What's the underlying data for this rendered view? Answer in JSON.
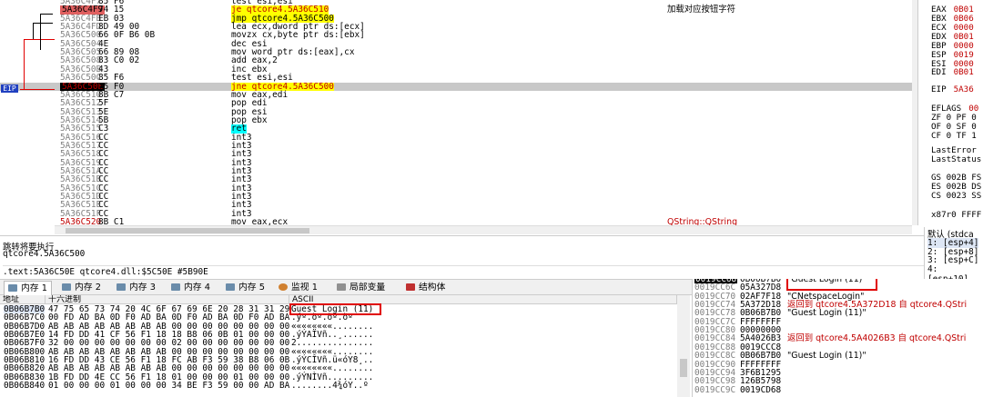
{
  "disasm": {
    "eip_label": "EIP",
    "rows": [
      {
        "addr": "5A36C4F7",
        "bytes": "85 F6",
        "instr": "test esi,esi",
        "cmt": "",
        "style": ""
      },
      {
        "addr": "5A36C4F9",
        "bytes": "74 15",
        "instr": "je qtcore4.5A36C510",
        "cmt": "加载对应按钮字符",
        "style": "sel"
      },
      {
        "addr": "5A36C4FB",
        "bytes": "EB 03",
        "instr": "jmp qtcore4.5A36C500",
        "cmt": "",
        "style": "jmp"
      },
      {
        "addr": "5A36C4FD",
        "bytes": "8D 49 00",
        "instr": "lea ecx,dword ptr ds:[ecx]",
        "cmt": "",
        "style": ""
      },
      {
        "addr": "5A36C500",
        "bytes": "66 0F B6 0B",
        "instr": "movzx cx,byte ptr ds:[ebx]",
        "cmt": "",
        "style": ""
      },
      {
        "addr": "5A36C504",
        "bytes": "4E",
        "instr": "dec esi",
        "cmt": "",
        "style": ""
      },
      {
        "addr": "5A36C505",
        "bytes": "66 89 08",
        "instr": "mov word ptr ds:[eax],cx",
        "cmt": "",
        "style": ""
      },
      {
        "addr": "5A36C508",
        "bytes": "83 C0 02",
        "instr": "add eax,2",
        "cmt": "",
        "style": ""
      },
      {
        "addr": "5A36C50B",
        "bytes": "43",
        "instr": "inc ebx",
        "cmt": "",
        "style": ""
      },
      {
        "addr": "5A36C50C",
        "bytes": "85 F6",
        "instr": "test esi,esi",
        "cmt": "",
        "style": ""
      },
      {
        "addr": "5A36C50E",
        "bytes": "75 F0",
        "instr": "jne qtcore4.5A36C500",
        "cmt": "",
        "style": "eip"
      },
      {
        "addr": "5A36C510",
        "bytes": "8B C7",
        "instr": "mov eax,edi",
        "cmt": "",
        "style": ""
      },
      {
        "addr": "5A36C512",
        "bytes": "5F",
        "instr": "pop edi",
        "cmt": "",
        "style": ""
      },
      {
        "addr": "5A36C513",
        "bytes": "5E",
        "instr": "pop esi",
        "cmt": "",
        "style": ""
      },
      {
        "addr": "5A36C514",
        "bytes": "5B",
        "instr": "pop ebx",
        "cmt": "",
        "style": ""
      },
      {
        "addr": "5A36C515",
        "bytes": "C3",
        "instr": "ret",
        "cmt": "",
        "style": "ret"
      },
      {
        "addr": "5A36C516",
        "bytes": "CC",
        "instr": "int3",
        "cmt": "",
        "style": ""
      },
      {
        "addr": "5A36C517",
        "bytes": "CC",
        "instr": "int3",
        "cmt": "",
        "style": ""
      },
      {
        "addr": "5A36C518",
        "bytes": "CC",
        "instr": "int3",
        "cmt": "",
        "style": ""
      },
      {
        "addr": "5A36C519",
        "bytes": "CC",
        "instr": "int3",
        "cmt": "",
        "style": ""
      },
      {
        "addr": "5A36C51A",
        "bytes": "CC",
        "instr": "int3",
        "cmt": "",
        "style": ""
      },
      {
        "addr": "5A36C51B",
        "bytes": "CC",
        "instr": "int3",
        "cmt": "",
        "style": ""
      },
      {
        "addr": "5A36C51C",
        "bytes": "CC",
        "instr": "int3",
        "cmt": "",
        "style": ""
      },
      {
        "addr": "5A36C51D",
        "bytes": "CC",
        "instr": "int3",
        "cmt": "",
        "style": ""
      },
      {
        "addr": "5A36C51E",
        "bytes": "CC",
        "instr": "int3",
        "cmt": "",
        "style": ""
      },
      {
        "addr": "5A36C51F",
        "bytes": "CC",
        "instr": "int3",
        "cmt": "",
        "style": ""
      },
      {
        "addr": "5A36C520",
        "bytes": "8B C1",
        "instr": "mov eax,ecx",
        "cmt": "QString::QString",
        "style": "red"
      }
    ]
  },
  "registers": {
    "rows": [
      {
        "name": "EAX",
        "val": "0B01"
      },
      {
        "name": "EBX",
        "val": "0B06"
      },
      {
        "name": "ECX",
        "val": "0000"
      },
      {
        "name": "EDX",
        "val": "0B01"
      },
      {
        "name": "EBP",
        "val": "0000"
      },
      {
        "name": "ESP",
        "val": "0019"
      },
      {
        "name": "ESI",
        "val": "0000"
      },
      {
        "name": "EDI",
        "val": "0B01"
      },
      {
        "name": "EIP",
        "val": "5A36"
      },
      {
        "name": "EFLAGS",
        "val": "00"
      },
      {
        "name": "ZF 0  PF 0",
        "val": ""
      },
      {
        "name": "OF 0  SF 0",
        "val": ""
      },
      {
        "name": "CF 0  TF 1",
        "val": ""
      },
      {
        "name": "LastError",
        "val": ""
      },
      {
        "name": "LastStatus",
        "val": ""
      },
      {
        "name": "GS 002B  FS",
        "val": ""
      },
      {
        "name": "ES 002B  DS",
        "val": ""
      },
      {
        "name": "CS 0023  SS",
        "val": ""
      },
      {
        "name": "x87r0 FFFF",
        "val": ""
      }
    ]
  },
  "info": {
    "line1": "跳转将要执行",
    "line2": "qtcore4.5A36C500",
    "line3": ".text:5A36C50E qtcore4.dll:$5C50E #5B90E"
  },
  "callstack": {
    "header": "默认 (stdca",
    "rows": [
      "1: [esp+4]",
      "2: [esp+8]",
      "3: [esp+C]",
      "4: [esp+10]"
    ]
  },
  "tabs": [
    {
      "label": "内存 1",
      "active": true
    },
    {
      "label": "内存 2",
      "active": false
    },
    {
      "label": "内存 3",
      "active": false
    },
    {
      "label": "内存 4",
      "active": false
    },
    {
      "label": "内存 5",
      "active": false
    },
    {
      "label": "监视 1",
      "active": false
    },
    {
      "label": "局部变量",
      "active": false
    },
    {
      "label": "结构体",
      "active": false
    }
  ],
  "dump": {
    "col_addr": "地址",
    "col_hex": "十六进制",
    "col_ascii": "ASCII",
    "rows": [
      {
        "addr": "0B06B7B0",
        "hex": "47 75 65 73 74 20 4C 6F 67 69 6E 20 28 31 31 29",
        "ascii": "Guest Login (11)"
      },
      {
        "addr": "0B06B7C0",
        "hex": "00 FD AD BA 0D F0 AD BA 0D F0 AD BA 0D F0 AD BA",
        "ascii": ".ý­º.ð­º.ð­º.ð­º"
      },
      {
        "addr": "0B06B7D0",
        "hex": "AB AB AB AB AB AB AB AB 00 00 00 00 00 00 00 00",
        "ascii": "««««««««........"
      },
      {
        "addr": "0B06B7E0",
        "hex": "14 FD DD 41 CF 56 F1 18 18 B8 06 0B 01 00 00 00",
        "ascii": ".ýÝAÏVñ..¸......"
      },
      {
        "addr": "0B06B7F0",
        "hex": "32 00 00 00 00 00 00 00 02 00 00 00 00 00 00 00",
        "ascii": "2..............."
      },
      {
        "addr": "0B06B800",
        "hex": "AB AB AB AB AB AB AB AB 00 00 00 00 00 00 00 00",
        "ascii": "««««««««........"
      },
      {
        "addr": "0B06B810",
        "hex": "16 FD DD 43 CE 56 F1 18 FC AB F3 59 38 B8 06 0B",
        "ascii": ".ýÝCÎVñ.ü«óY8¸.."
      },
      {
        "addr": "0B06B820",
        "hex": "AB AB AB AB AB AB AB AB 00 00 00 00 00 00 00 00",
        "ascii": "««««««««........"
      },
      {
        "addr": "0B06B830",
        "hex": "1B FD DD 4E CC 56 F1 18 01 00 00 00 01 00 00 00",
        "ascii": ".ýÝNÌVñ........."
      },
      {
        "addr": "0B06B840",
        "hex": "01 00 00 00 01 00 00 00 34 BE F3 59 00 00 AD BA",
        "ascii": "........4¾óY..­º"
      }
    ]
  },
  "stack": {
    "rows": [
      {
        "addr": "0019CC68",
        "val": "0B06B7B0",
        "cmt": "\"Guest Login (11)\"",
        "red": false,
        "sel": true
      },
      {
        "addr": "0019CC6C",
        "val": "05A327D8",
        "cmt": "",
        "red": false,
        "sel": false
      },
      {
        "addr": "0019CC70",
        "val": "02AF7F18",
        "cmt": "\"CNetspaceLogin\"",
        "red": false,
        "sel": false
      },
      {
        "addr": "0019CC74",
        "val": "5A372D18",
        "cmt": "返回到 qtcore4.5A372D18 自 qtcore4.QStri",
        "red": true,
        "sel": false
      },
      {
        "addr": "0019CC78",
        "val": "0B06B7B0",
        "cmt": "\"Guest Login (11)\"",
        "red": false,
        "sel": false
      },
      {
        "addr": "0019CC7C",
        "val": "FFFFFFFF",
        "cmt": "",
        "red": false,
        "sel": false
      },
      {
        "addr": "0019CC80",
        "val": "00000000",
        "cmt": "",
        "red": false,
        "sel": false
      },
      {
        "addr": "0019CC84",
        "val": "5A4026B3",
        "cmt": "返回到 qtcore4.5A4026B3 自 qtcore4.QStri",
        "red": true,
        "sel": false
      },
      {
        "addr": "0019CC88",
        "val": "0019CCC8",
        "cmt": "",
        "red": false,
        "sel": false
      },
      {
        "addr": "0019CC8C",
        "val": "0B06B7B0",
        "cmt": "\"Guest Login (11)\"",
        "red": false,
        "sel": false
      },
      {
        "addr": "0019CC90",
        "val": "FFFFFFFF",
        "cmt": "",
        "red": false,
        "sel": false
      },
      {
        "addr": "0019CC94",
        "val": "3F6B1295",
        "cmt": "",
        "red": false,
        "sel": false
      },
      {
        "addr": "0019CC98",
        "val": "126B5798",
        "cmt": "",
        "red": false,
        "sel": false
      },
      {
        "addr": "0019CC9C",
        "val": "0019CD68",
        "cmt": "",
        "red": false,
        "sel": false
      }
    ]
  }
}
